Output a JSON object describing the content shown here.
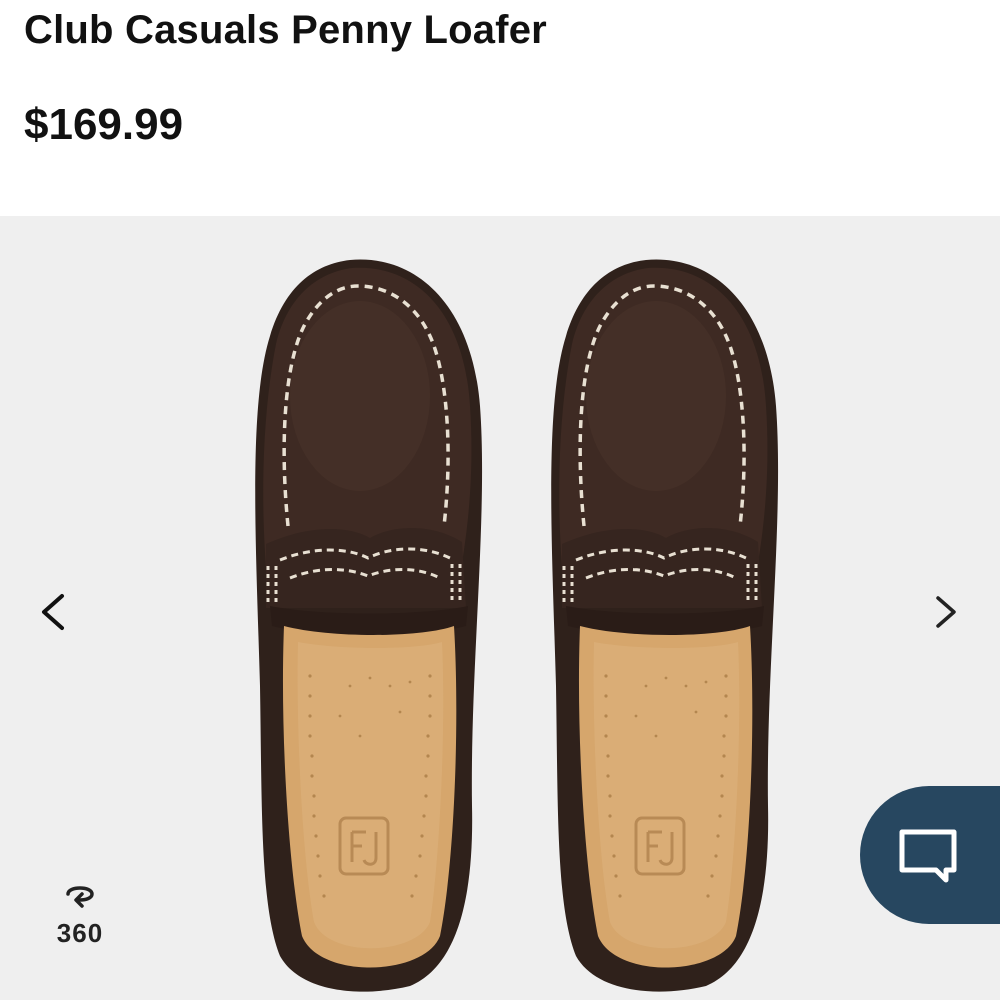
{
  "product": {
    "title": "Club Casuals Penny Loafer",
    "price": "$169.99"
  },
  "gallery": {
    "image_alt": "Club Casuals Penny Loafer shoes, top view",
    "prev_icon": "chevron-left-icon",
    "next_icon": "chevron-right-icon",
    "view_360": {
      "label": "360",
      "icon": "rotate-360-icon"
    }
  },
  "chat": {
    "icon": "chat-bubble-icon"
  },
  "colors": {
    "leather": "#3e2a23",
    "lining": "#d6a66c",
    "stitching": "#e8e0d2",
    "gallery_background": "#efefef",
    "chat_button": "#274760"
  }
}
